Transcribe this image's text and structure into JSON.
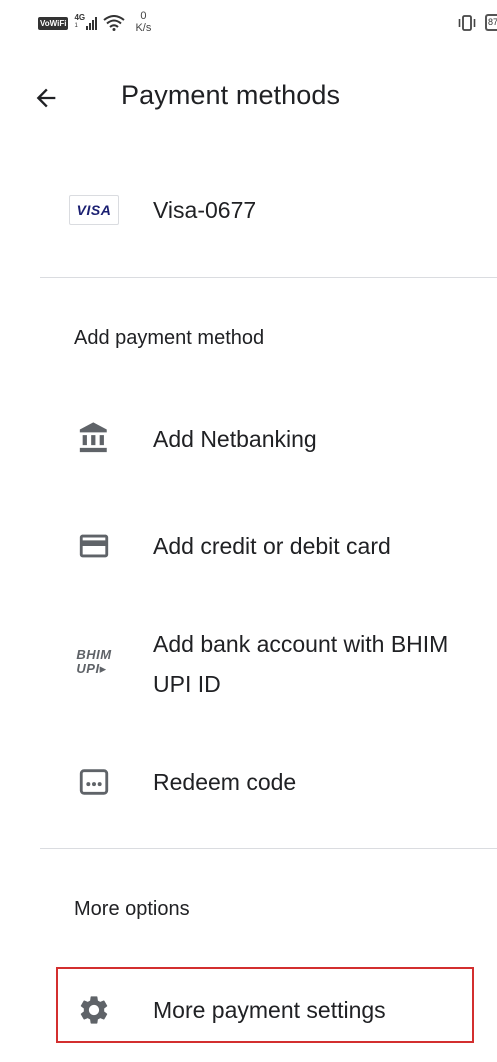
{
  "status_bar": {
    "vowifi": "VoWiFi",
    "network": "4G",
    "network_sub": "1",
    "speed_value": "0",
    "speed_unit": "K/s",
    "battery": "87"
  },
  "header": {
    "title": "Payment methods"
  },
  "saved_methods": [
    {
      "brand": "VISA",
      "label": "Visa-0677"
    }
  ],
  "add_section": {
    "heading": "Add payment method",
    "items": [
      {
        "icon": "bank-icon",
        "label": "Add Netbanking"
      },
      {
        "icon": "credit-card-icon",
        "label": "Add credit or debit card"
      },
      {
        "icon": "bhim-upi-icon",
        "label": "Add bank account with BHIM UPI ID",
        "logo_line1": "BHIM",
        "logo_line2": "UPI"
      },
      {
        "icon": "redeem-code-icon",
        "label": "Redeem code"
      }
    ]
  },
  "more_section": {
    "heading": "More options",
    "items": [
      {
        "icon": "gear-icon",
        "label": "More payment settings"
      }
    ]
  },
  "colors": {
    "text": "#202124",
    "icon": "#5f6368",
    "divider": "#dadce0",
    "highlight": "#d32f2f",
    "visa": "#1a1f71"
  }
}
